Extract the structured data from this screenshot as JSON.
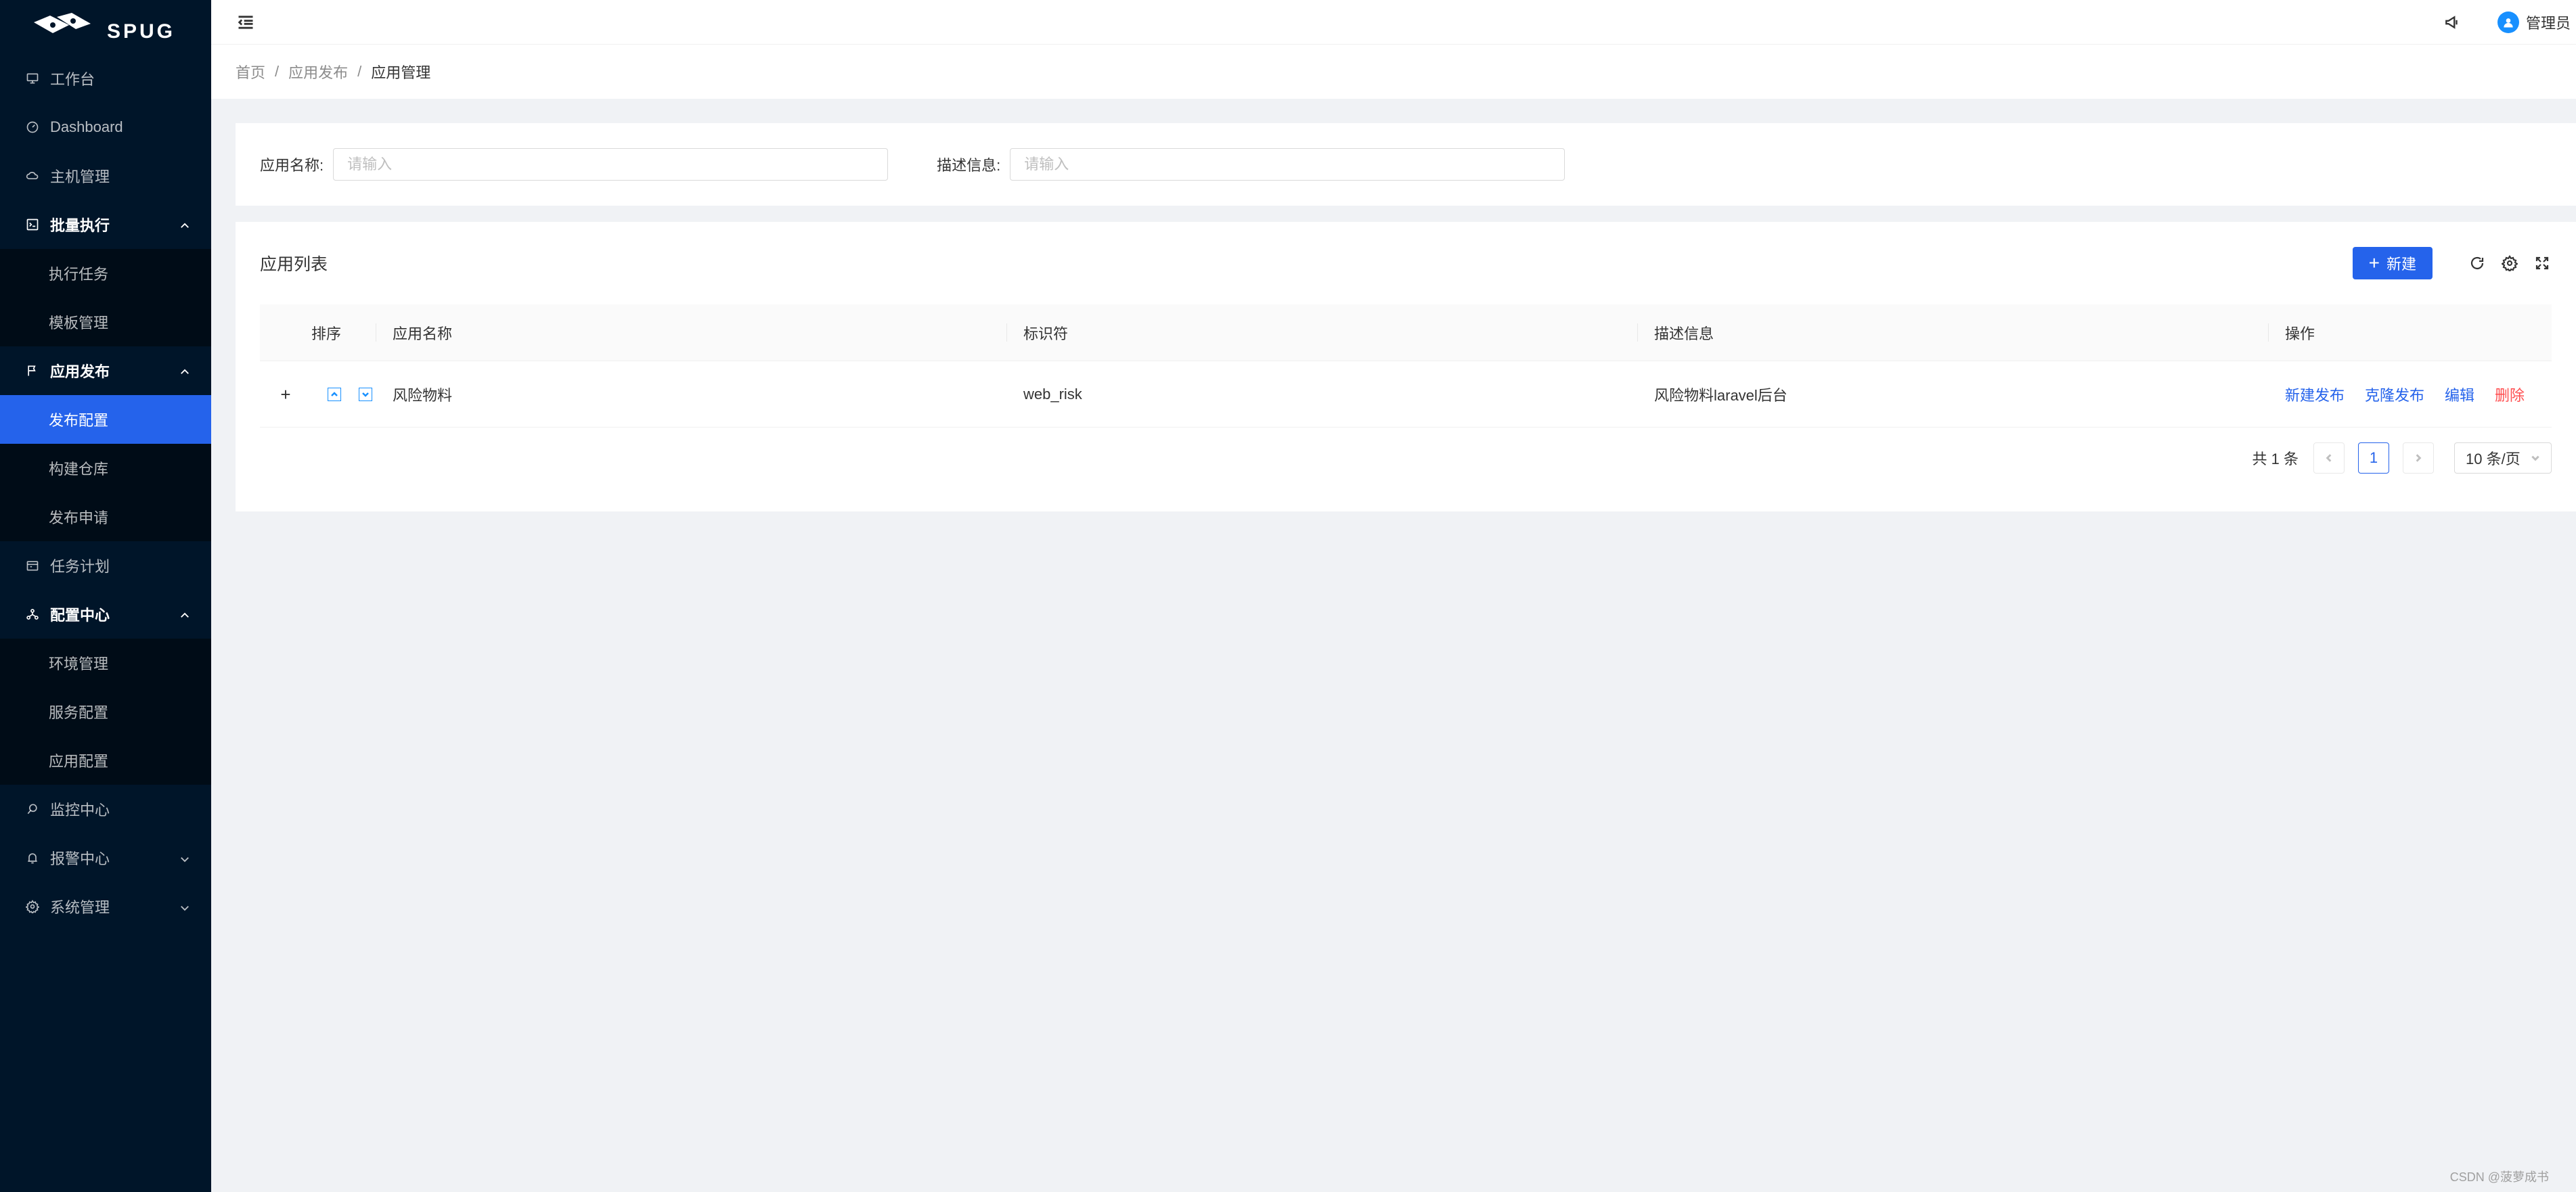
{
  "logo": {
    "text": "SPUG"
  },
  "sidebar": {
    "items": [
      {
        "label": "工作台",
        "icon": "desktop-icon"
      },
      {
        "label": "Dashboard",
        "icon": "dashboard-icon"
      },
      {
        "label": "主机管理",
        "icon": "cloud-server-icon"
      },
      {
        "label": "批量执行",
        "icon": "code-icon",
        "children": [
          "执行任务",
          "模板管理"
        ]
      },
      {
        "label": "应用发布",
        "icon": "flag-icon",
        "children": [
          "发布配置",
          "构建仓库",
          "发布申请"
        ],
        "active_child": "发布配置"
      },
      {
        "label": "任务计划",
        "icon": "schedule-icon"
      },
      {
        "label": "配置中心",
        "icon": "cluster-icon",
        "children": [
          "环境管理",
          "服务配置",
          "应用配置"
        ]
      },
      {
        "label": "监控中心",
        "icon": "monitor-icon"
      },
      {
        "label": "报警中心",
        "icon": "alert-icon"
      },
      {
        "label": "系统管理",
        "icon": "setting-icon"
      }
    ]
  },
  "header": {
    "username": "管理员"
  },
  "breadcrumb": [
    "首页",
    "应用发布",
    "应用管理"
  ],
  "search": {
    "name_label": "应用名称:",
    "name_placeholder": "请输入",
    "desc_label": "描述信息:",
    "desc_placeholder": "请输入"
  },
  "table": {
    "title": "应用列表",
    "new_button": "新建",
    "columns": [
      "排序",
      "应用名称",
      "标识符",
      "描述信息",
      "操作"
    ],
    "rows": [
      {
        "name": "风险物料",
        "key": "web_risk",
        "desc": "风险物料laravel后台"
      }
    ],
    "actions": [
      "新建发布",
      "克隆发布",
      "编辑",
      "删除"
    ]
  },
  "pagination": {
    "total": "共 1 条",
    "current": "1",
    "page_size": "10 条/页"
  },
  "watermark": "CSDN @菠萝成书",
  "colors": {
    "sidebar_bg": "#001529",
    "primary": "#2563eb",
    "danger": "#ff4d4f",
    "page_bg": "#f0f2f5"
  }
}
